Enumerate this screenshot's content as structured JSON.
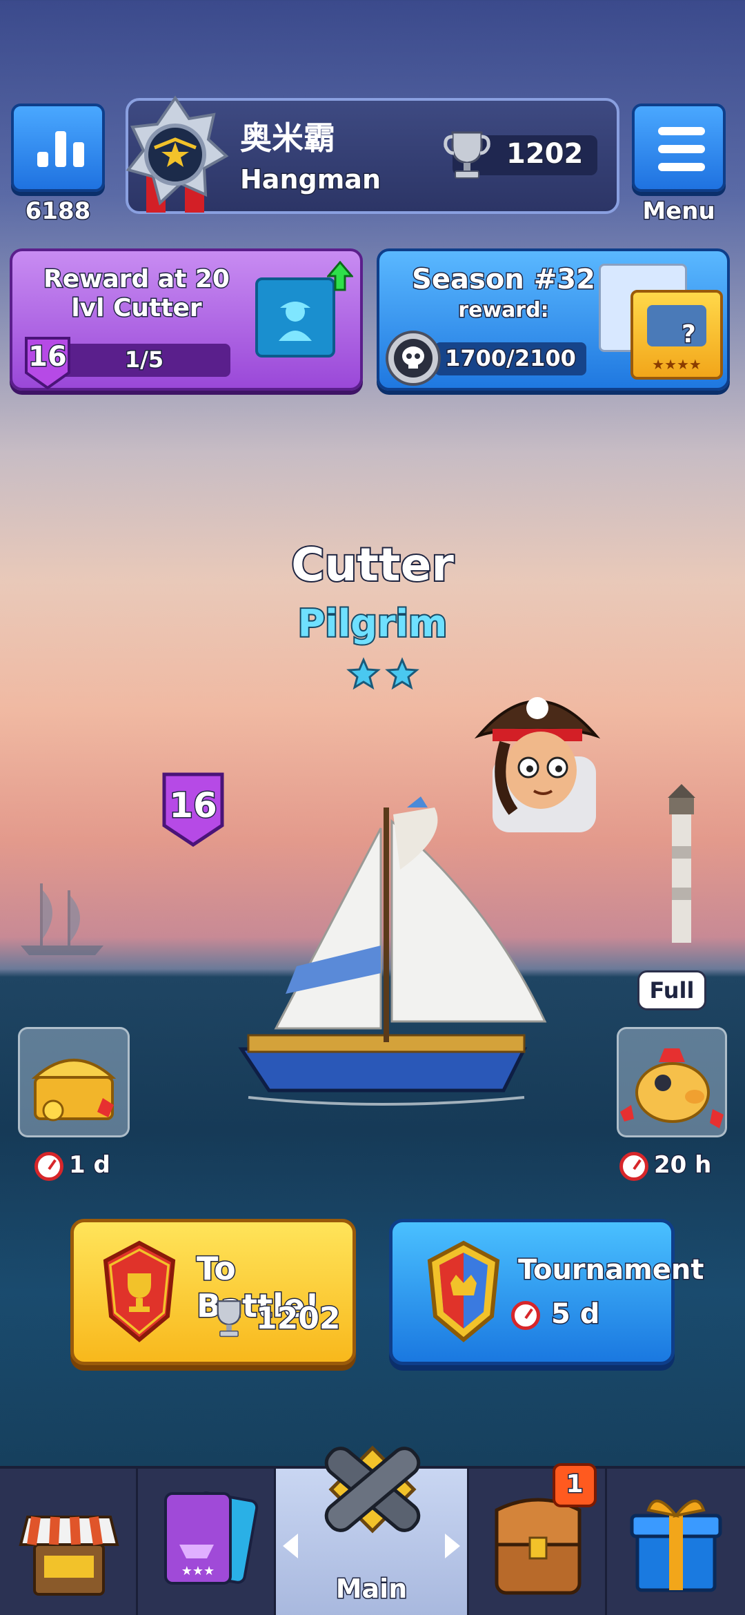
{
  "top_bar": {
    "stats_value": "6188",
    "player_name_cn": "奥米霸",
    "player_rank": "Hangman",
    "trophies": "1202",
    "menu_label": "Menu"
  },
  "reward_card": {
    "title_line1": "Reward at 20",
    "title_line2": "lvl Cutter",
    "level": "16",
    "progress_text": "1/5",
    "progress_value": 0.2
  },
  "season_card": {
    "title": "Season #32",
    "subtitle": "reward:",
    "progress_text": "1700/2100",
    "progress_value": 0.81,
    "mystery_mark": "?",
    "stars": "★★★★"
  },
  "ship": {
    "name": "Cutter",
    "class": "Pilgrim",
    "stars": 2,
    "level": "16"
  },
  "side_items": {
    "chest_timer": "1 d",
    "piggy_status": "Full",
    "piggy_timer": "20 h"
  },
  "actions": {
    "battle_label": "To Battle!",
    "battle_trophies": "1202",
    "tournament_label": "Tournament",
    "tournament_timer": "5 d"
  },
  "bottom_nav": {
    "items": [
      {
        "icon": "shop-icon"
      },
      {
        "icon": "cards-icon"
      },
      {
        "icon": "cannons-icon",
        "label": "Main",
        "active": true
      },
      {
        "icon": "backpack-icon",
        "badge": "1"
      },
      {
        "icon": "gift-icon"
      }
    ]
  },
  "colors": {
    "accent_blue": "#1f72e0",
    "accent_purple": "#9a48d8",
    "accent_yellow": "#f8b81c",
    "nav_bg": "#2b3253"
  }
}
